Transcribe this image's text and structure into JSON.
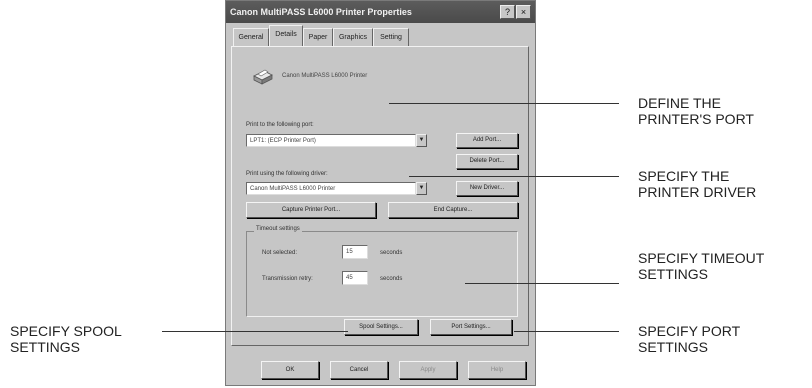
{
  "dialog": {
    "title": "Canon MultiPASS L6000 Printer Properties",
    "title_buttons": [
      "?",
      "×"
    ],
    "tabs": [
      "General",
      "Details",
      "Paper",
      "Graphics",
      "Setting"
    ],
    "active_tab": "Details",
    "printer_name": "Canon MultiPASS L6000 Printer",
    "port_label": "Print to the following port:",
    "port_value": "LPT1: (ECP Printer Port)",
    "add_port": "Add Port...",
    "delete_port": "Delete Port...",
    "driver_label": "Print using the following driver:",
    "driver_value": "Canon MultiPASS L6000 Printer",
    "new_driver": "New Driver...",
    "capture_port": "Capture Printer Port...",
    "end_capture": "End Capture...",
    "timeout_group": "Timeout settings",
    "not_selected_label": "Not selected:",
    "not_selected_value": "15",
    "transmission_label": "Transmission retry:",
    "transmission_value": "45",
    "seconds": "seconds",
    "spool_settings": "Spool Settings...",
    "port_settings": "Port Settings...",
    "ok": "OK",
    "cancel": "Cancel",
    "apply": "Apply",
    "help": "Help"
  },
  "callouts": {
    "define_port": [
      "DEFINE THE",
      "PRINTER'S PORT"
    ],
    "specify_driver": [
      "SPECIFY THE",
      "PRINTER DRIVER"
    ],
    "specify_timeout": [
      "SPECIFY TIMEOUT",
      "SETTINGS"
    ],
    "specify_spool": [
      "SPECIFY SPOOL",
      "SETTINGS"
    ],
    "specify_port": [
      "SPECIFY PORT",
      "SETTINGS"
    ]
  }
}
